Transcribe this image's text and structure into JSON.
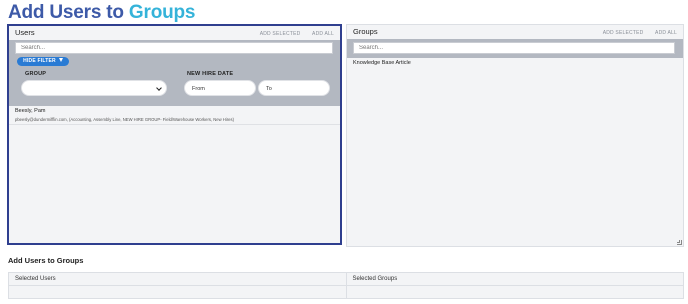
{
  "page": {
    "title_part1": "Add Users to ",
    "title_part2": "Groups"
  },
  "users_panel": {
    "title": "Users",
    "add_selected": "ADD SELECTED",
    "add_all": "ADD ALL",
    "search_placeholder": "Search...",
    "hide_filter_label": "HIDE FILTER",
    "group_label": "GROUP",
    "group_selected": "",
    "new_hire_label": "NEW HIRE DATE",
    "from_placeholder": "From",
    "to_placeholder": "To",
    "users": [
      {
        "name": "Beesly, Pam",
        "detail": "pbeesly@dundermifflin.com, (Accounting, Assembly Line, NEW HIRE GROUP- Field/Warehouse Workers, New Hires)"
      }
    ]
  },
  "groups_panel": {
    "title": "Groups",
    "add_selected": "ADD SELECTED",
    "add_all": "ADD ALL",
    "search_placeholder": "Search...",
    "groups": [
      "Knowledge Base Article"
    ]
  },
  "selection": {
    "section_title": "Add Users to Groups",
    "selected_users_label": "Selected Users",
    "selected_groups_label": "Selected Groups"
  },
  "colors": {
    "title_primary": "#3d5aa8",
    "title_accent": "#35b3d9",
    "focus_border": "#2f3f8f",
    "filter_button": "#2a7bd4",
    "filter_area": "#b3b8c1"
  },
  "icons": [
    "filter-icon",
    "chevron-down-icon",
    "resize-grip-icon"
  ]
}
